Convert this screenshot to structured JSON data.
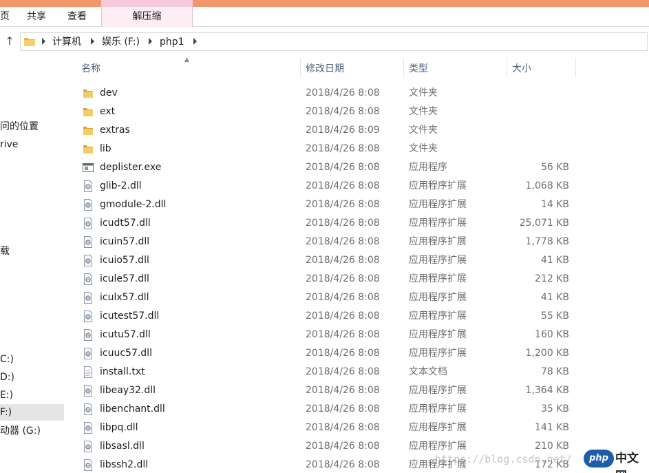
{
  "ribbon": {
    "tabs": [
      {
        "label": "页"
      },
      {
        "label": "共享"
      },
      {
        "label": "查看"
      },
      {
        "label": "解压缩"
      }
    ]
  },
  "address": {
    "crumbs": [
      "计算机",
      "娱乐 (F:)",
      "php1"
    ]
  },
  "nav": {
    "items": [
      {
        "label": "问的位置"
      },
      {
        "label": "rive"
      },
      {
        "label": "载"
      },
      {
        "label": "C:)"
      },
      {
        "label": "D:)"
      },
      {
        "label": "E:)"
      },
      {
        "label": "F:)"
      },
      {
        "label": "动器 (G:)"
      }
    ]
  },
  "columns": {
    "name": "名称",
    "date": "修改日期",
    "type": "类型",
    "size": "大小"
  },
  "files": [
    {
      "name": "dev",
      "date": "2018/4/26 8:08",
      "type": "文件夹",
      "size": "",
      "icon": "folder-icon"
    },
    {
      "name": "ext",
      "date": "2018/4/26 8:08",
      "type": "文件夹",
      "size": "",
      "icon": "folder-icon"
    },
    {
      "name": "extras",
      "date": "2018/4/26 8:09",
      "type": "文件夹",
      "size": "",
      "icon": "folder-icon"
    },
    {
      "name": "lib",
      "date": "2018/4/26 8:08",
      "type": "文件夹",
      "size": "",
      "icon": "folder-icon"
    },
    {
      "name": "deplister.exe",
      "date": "2018/4/26 8:08",
      "type": "应用程序",
      "size": "56 KB",
      "icon": "exe-icon"
    },
    {
      "name": "glib-2.dll",
      "date": "2018/4/26 8:08",
      "type": "应用程序扩展",
      "size": "1,068 KB",
      "icon": "dll-icon"
    },
    {
      "name": "gmodule-2.dll",
      "date": "2018/4/26 8:08",
      "type": "应用程序扩展",
      "size": "14 KB",
      "icon": "dll-icon"
    },
    {
      "name": "icudt57.dll",
      "date": "2018/4/26 8:08",
      "type": "应用程序扩展",
      "size": "25,071 KB",
      "icon": "dll-icon"
    },
    {
      "name": "icuin57.dll",
      "date": "2018/4/26 8:08",
      "type": "应用程序扩展",
      "size": "1,778 KB",
      "icon": "dll-icon"
    },
    {
      "name": "icuio57.dll",
      "date": "2018/4/26 8:08",
      "type": "应用程序扩展",
      "size": "41 KB",
      "icon": "dll-icon"
    },
    {
      "name": "icule57.dll",
      "date": "2018/4/26 8:08",
      "type": "应用程序扩展",
      "size": "212 KB",
      "icon": "dll-icon"
    },
    {
      "name": "iculx57.dll",
      "date": "2018/4/26 8:08",
      "type": "应用程序扩展",
      "size": "41 KB",
      "icon": "dll-icon"
    },
    {
      "name": "icutest57.dll",
      "date": "2018/4/26 8:08",
      "type": "应用程序扩展",
      "size": "55 KB",
      "icon": "dll-icon"
    },
    {
      "name": "icutu57.dll",
      "date": "2018/4/26 8:08",
      "type": "应用程序扩展",
      "size": "160 KB",
      "icon": "dll-icon"
    },
    {
      "name": "icuuc57.dll",
      "date": "2018/4/26 8:08",
      "type": "应用程序扩展",
      "size": "1,200 KB",
      "icon": "dll-icon"
    },
    {
      "name": "install.txt",
      "date": "2018/4/26 8:08",
      "type": "文本文档",
      "size": "78 KB",
      "icon": "text-file-icon"
    },
    {
      "name": "libeay32.dll",
      "date": "2018/4/26 8:08",
      "type": "应用程序扩展",
      "size": "1,364 KB",
      "icon": "dll-icon"
    },
    {
      "name": "libenchant.dll",
      "date": "2018/4/26 8:08",
      "type": "应用程序扩展",
      "size": "35 KB",
      "icon": "dll-icon"
    },
    {
      "name": "libpq.dll",
      "date": "2018/4/26 8:08",
      "type": "应用程序扩展",
      "size": "141 KB",
      "icon": "dll-icon"
    },
    {
      "name": "libsasl.dll",
      "date": "2018/4/26 8:08",
      "type": "应用程序扩展",
      "size": "210 KB",
      "icon": "dll-icon"
    },
    {
      "name": "libssh2.dll",
      "date": "2018/4/26 8:08",
      "type": "应用程序扩展",
      "size": "172 KB",
      "icon": "dll-icon"
    }
  ],
  "watermark": {
    "url": "https://blog.csdn.net/",
    "logo_mark": "php",
    "logo_text": "中文网"
  },
  "colors": {
    "title_strip": "#f0976c",
    "context_tab": "#f7c9dd",
    "folder": "#e8b84a",
    "header_text": "#4c607a"
  }
}
